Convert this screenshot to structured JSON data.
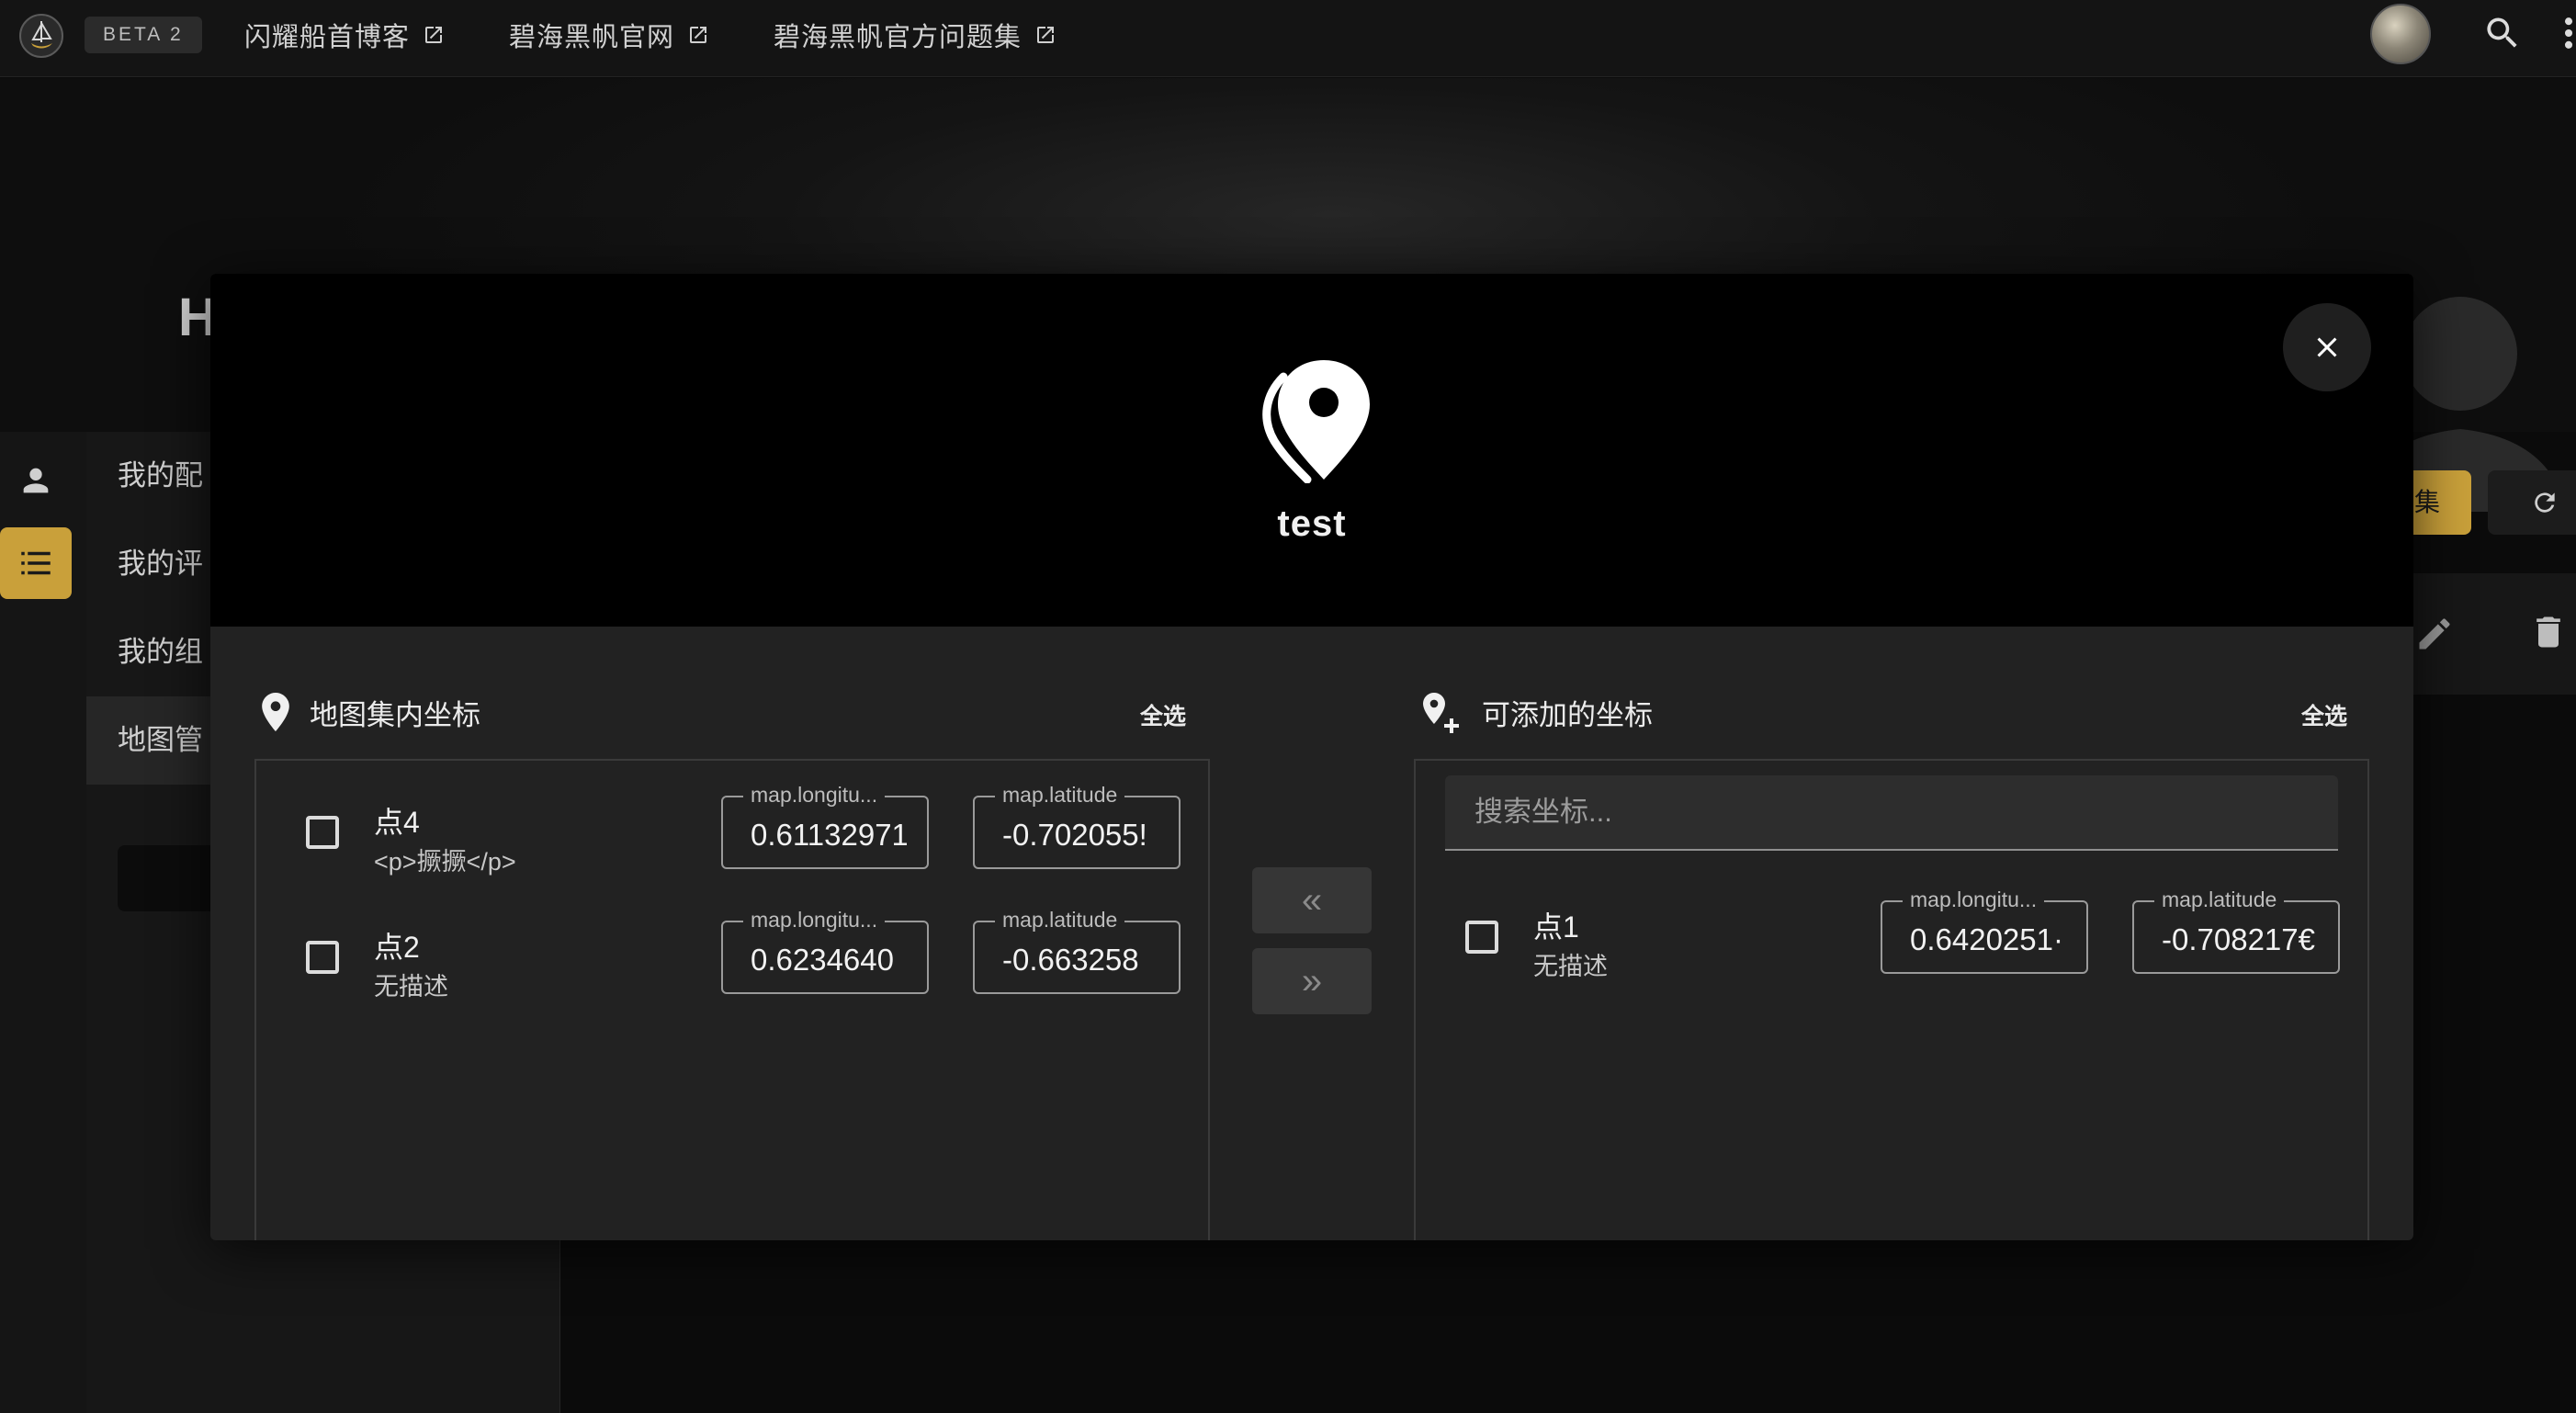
{
  "topbar": {
    "beta": "BETA 2",
    "links": [
      {
        "label": "闪耀船首博客"
      },
      {
        "label": "碧海黑帆官网"
      },
      {
        "label": "碧海黑帆官方问题集"
      }
    ]
  },
  "background": {
    "hero_letter": "H",
    "sidebar": [
      {
        "label": "我的配"
      },
      {
        "label": "我的评"
      },
      {
        "label": "我的组"
      },
      {
        "label": "地图管"
      }
    ],
    "right_button": "集"
  },
  "modal": {
    "title": "test",
    "left_panel": {
      "title": "地图集内坐标",
      "select_all": "全选",
      "items": [
        {
          "name": "点4",
          "desc": "<p>撅撅</p>",
          "lng_label": "map.longitu...",
          "lng": "0.61132971",
          "lat_label": "map.latitude",
          "lat": "-0.702055!"
        },
        {
          "name": "点2",
          "desc": "无描述",
          "lng_label": "map.longitu...",
          "lng": "0.6234640",
          "lat_label": "map.latitude",
          "lat": "-0.663258"
        }
      ]
    },
    "move_left": "«",
    "move_right": "»",
    "right_panel": {
      "title": "可添加的坐标",
      "select_all": "全选",
      "search_placeholder": "搜索坐标...",
      "items": [
        {
          "name": "点1",
          "desc": "无描述",
          "lng_label": "map.longitu...",
          "lng": "0.6420251·",
          "lat_label": "map.latitude",
          "lat": "-0.708217€"
        }
      ]
    }
  },
  "colors": {
    "accent": "#c9a03a",
    "modal_bg": "#222222",
    "modal_header": "#000000",
    "topbar": "#141414"
  }
}
